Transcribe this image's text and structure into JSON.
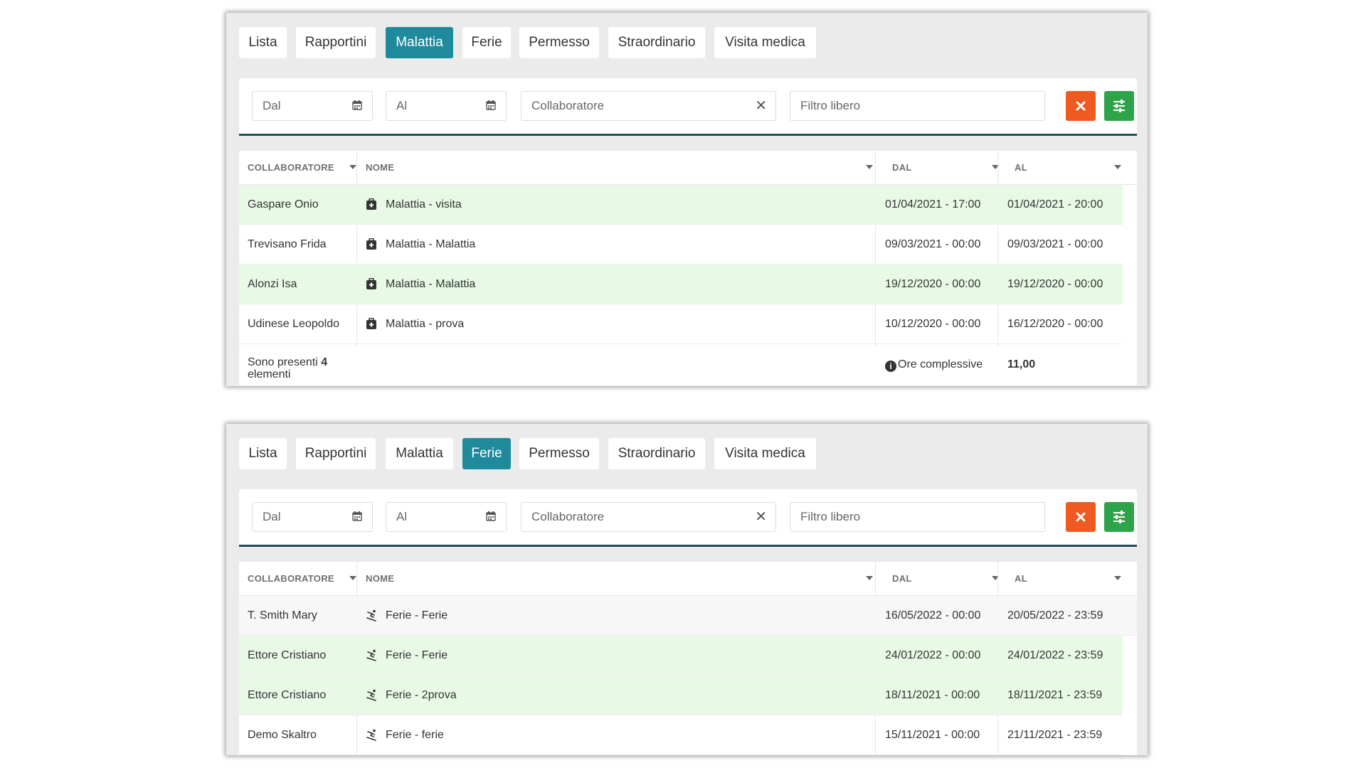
{
  "tabs": [
    "Lista",
    "Rapportini",
    "Malattia",
    "Ferie",
    "Permesso",
    "Straordinario",
    "Visita medica"
  ],
  "panels": [
    {
      "active_tab": "Malattia",
      "filters": {
        "dal": "Dal",
        "al": "Al",
        "collaboratore": "Collaboratore",
        "clear_symbol": "✕",
        "filtro": "Filtro libero"
      },
      "columns": [
        "COLLABORATORE",
        "NOME",
        "DAL",
        "AL"
      ],
      "rows": [
        {
          "collaboratore": "Gaspare Onio",
          "nome": "Malattia - visita",
          "dal": "01/04/2021 - 17:00",
          "al": "01/04/2021 - 20:00"
        },
        {
          "collaboratore": "Trevisano Frida",
          "nome": "Malattia - Malattia",
          "dal": "09/03/2021 - 00:00",
          "al": "09/03/2021 - 00:00"
        },
        {
          "collaboratore": "Alonzi Isa",
          "nome": "Malattia - Malattia",
          "dal": "19/12/2020 - 00:00",
          "al": "19/12/2020 - 00:00"
        },
        {
          "collaboratore": "Udinese Leopoldo",
          "nome": "Malattia - prova",
          "dal": "10/12/2020 - 00:00",
          "al": "16/12/2020 - 00:00"
        }
      ],
      "footer": {
        "presenti_prefix": "Sono presenti",
        "presenti_count": "4",
        "presenti_suffix": "elementi",
        "info_glyph": "i",
        "ore_label": "Ore complessive",
        "ore_value": "11,00"
      }
    },
    {
      "active_tab": "Ferie",
      "filters": {
        "dal": "Dal",
        "al": "Al",
        "collaboratore": "Collaboratore",
        "clear_symbol": "✕",
        "filtro": "Filtro libero"
      },
      "columns": [
        "COLLABORATORE",
        "NOME",
        "DAL",
        "AL"
      ],
      "rows": [
        {
          "collaboratore": "T. Smith Mary",
          "nome": "Ferie - Ferie",
          "dal": "16/05/2022 - 00:00",
          "al": "20/05/2022 - 23:59"
        },
        {
          "collaboratore": "Ettore Cristiano",
          "nome": "Ferie - Ferie",
          "dal": "24/01/2022 - 00:00",
          "al": "24/01/2022 - 23:59"
        },
        {
          "collaboratore": "Ettore Cristiano",
          "nome": "Ferie - 2prova",
          "dal": "18/11/2021 - 00:00",
          "al": "18/11/2021 - 23:59"
        },
        {
          "collaboratore": "Demo Skaltro",
          "nome": "Ferie - ferie",
          "dal": "15/11/2021 - 00:00",
          "al": "21/11/2021 - 23:59"
        }
      ]
    }
  ],
  "colors": {
    "accent": "#1e8a9c",
    "clear_button": "#ee5a1f",
    "settings_button": "#2ea44a",
    "row_highlight": "#e8fae6",
    "filter_border": "#1f4e57"
  },
  "icons": {
    "calendar": "calendar-icon",
    "clear": "close-icon",
    "reset": "close-icon",
    "settings": "sliders-icon",
    "malattia": "medical-bag-icon",
    "ferie": "skiing-person-icon",
    "info": "info-icon"
  }
}
